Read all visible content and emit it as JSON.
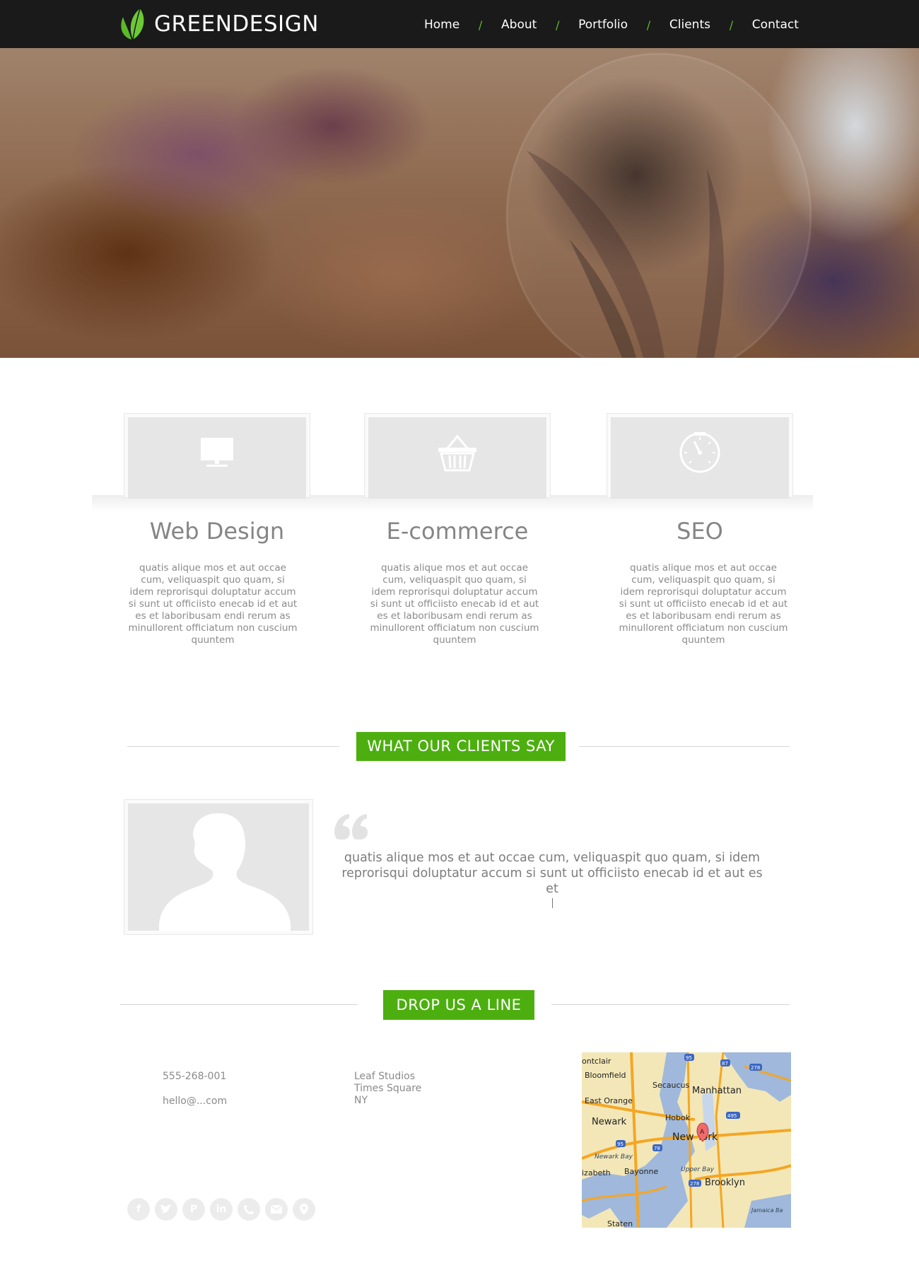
{
  "header": {
    "logo_text": "GREENDESIGN",
    "nav": [
      "Home",
      "About",
      "Portfolio",
      "Clients",
      "Contact"
    ],
    "nav_separator": "/"
  },
  "services": [
    {
      "icon": "monitor-icon",
      "title": "Web Design",
      "text": "quatis alique mos et aut occae cum, veliquaspit quo quam, si idem reprorisqui doluptatur accum si sunt ut officiisto enecab id et aut es et laboribusam endi rerum as minullorent officiatum non cuscium quuntem"
    },
    {
      "icon": "basket-icon",
      "title": "E-commerce",
      "text": "quatis alique mos et aut occae cum, veliquaspit quo quam, si idem reprorisqui doluptatur accum si sunt ut officiisto enecab id et aut es et laboribusam endi rerum as minullorent officiatum non cuscium quuntem"
    },
    {
      "icon": "speedometer-icon",
      "title": "SEO",
      "text": "quatis alique mos et aut occae cum, veliquaspit quo quam, si idem reprorisqui doluptatur accum si sunt ut officiisto enecab id et aut es et laboribusam endi rerum as minullorent officiatum non cuscium quuntem"
    }
  ],
  "testimonials": {
    "heading": "WHAT OUR CLIENTS SAY",
    "quote": "quatis alique mos et aut occae cum, veliquaspit quo quam, si idem reprorisqui doluptatur accum si sunt ut officiisto enecab id et aut es et"
  },
  "contact": {
    "heading": "DROP US A LINE",
    "phone": "555-268-001",
    "email": "hello@...com",
    "address": [
      "Leaf Studios",
      "Times Square",
      "NY"
    ],
    "socials": [
      "facebook-icon",
      "twitter-icon",
      "pinterest-icon",
      "linkedin-icon",
      "phone-icon",
      "mail-icon",
      "location-icon"
    ],
    "map": {
      "labels": [
        "ontclair",
        "Bloomfield",
        "Secaucus",
        "Manhattan",
        "East Orange",
        "Hobok",
        "Newark",
        "New York",
        "Newark Bay",
        "Upper Bay",
        "izabeth",
        "Bayonne",
        "Brooklyn",
        "Staten",
        "Jamaica Ba"
      ],
      "route_shields": [
        "95",
        "87",
        "278",
        "495",
        "78",
        "95",
        "278"
      ],
      "marker": "A"
    }
  },
  "colors": {
    "accent": "#4caf0f",
    "nav_bg": "#1a1a1a",
    "placeholder": "#e6e6e6"
  }
}
